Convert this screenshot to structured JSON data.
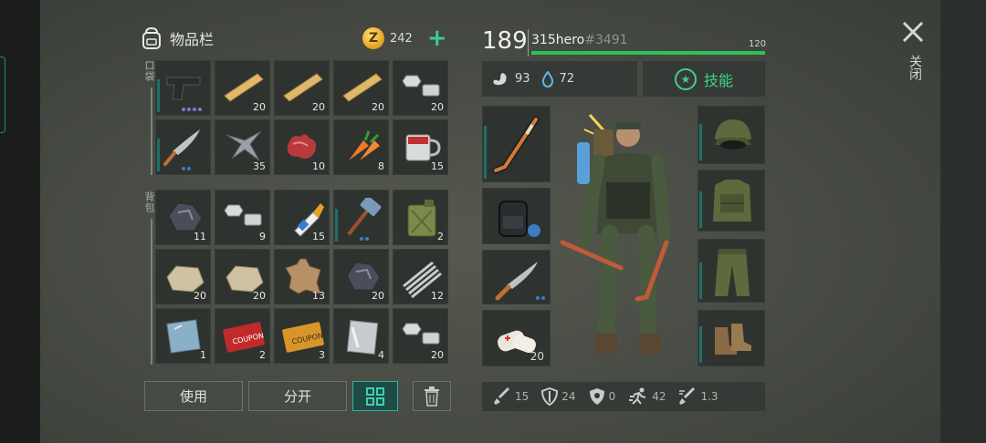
{
  "inventory": {
    "title": "物品栏",
    "coins": "242",
    "pocket_label": "口袋",
    "backpack_label": "背包",
    "pocket_slots": [
      {
        "item": "pistol",
        "count": "",
        "dots": 4
      },
      {
        "item": "wooden-plank",
        "count": "20"
      },
      {
        "item": "wooden-plank",
        "count": "20"
      },
      {
        "item": "wooden-plank",
        "count": "20"
      },
      {
        "item": "nut-bolt",
        "count": "20"
      },
      {
        "item": "machete",
        "count": ""
      },
      {
        "item": "metal-scrap",
        "count": "35"
      },
      {
        "item": "raw-meat",
        "count": "10"
      },
      {
        "item": "carrot",
        "count": "8"
      },
      {
        "item": "mug-of-water",
        "count": "15"
      }
    ],
    "backpack_slots": [
      {
        "item": "coal-ore",
        "count": "11"
      },
      {
        "item": "nut-bolt",
        "count": "9"
      },
      {
        "item": "glue",
        "count": "15"
      },
      {
        "item": "sledgehammer",
        "count": ""
      },
      {
        "item": "fuel-canister",
        "count": "2"
      },
      {
        "item": "limestone",
        "count": "20"
      },
      {
        "item": "limestone",
        "count": "20"
      },
      {
        "item": "leather-hide",
        "count": "13"
      },
      {
        "item": "coal-ore",
        "count": "20"
      },
      {
        "item": "spring",
        "count": "12"
      },
      {
        "item": "glass-pane",
        "count": "1"
      },
      {
        "item": "coupon-red",
        "count": "2",
        "text": "COUPON"
      },
      {
        "item": "coupon-gold",
        "count": "3",
        "text": "COUPON"
      },
      {
        "item": "steel-plate",
        "count": "4"
      },
      {
        "item": "nut-bolt",
        "count": "20"
      }
    ],
    "buttons": {
      "use": "使用",
      "split": "分开"
    }
  },
  "player": {
    "level": "189",
    "name": "315hero",
    "tag": "#3491",
    "xp": "120",
    "xp_fill": 1.0,
    "food": "93",
    "water": "72",
    "skills_label": "技能"
  },
  "equipment": {
    "weapon_slots": [
      {
        "item": "hockey-stick",
        "count": ""
      },
      {
        "item": "backpack",
        "count": ""
      },
      {
        "item": "machete",
        "count": ""
      },
      {
        "item": "bandage",
        "count": "20"
      }
    ],
    "armor_slots": [
      "military-cap",
      "military-vest",
      "military-pants",
      "boots"
    ]
  },
  "combat_stats": {
    "attack": "15",
    "defense": "24",
    "resist": "0",
    "speed": "42",
    "attack_speed": "1.3"
  },
  "close_label": "关闭",
  "colors": {
    "accent": "#3fd08a",
    "xp_bar": "#2fc05a",
    "durability": "#1f6f6a"
  }
}
